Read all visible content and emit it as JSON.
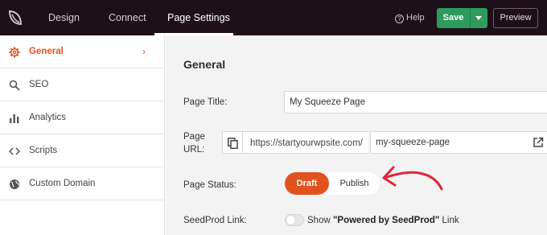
{
  "header": {
    "tabs": [
      {
        "label": "Design",
        "active": false
      },
      {
        "label": "Connect",
        "active": false
      },
      {
        "label": "Page Settings",
        "active": true
      }
    ],
    "help_label": "Help",
    "save_label": "Save",
    "preview_label": "Preview"
  },
  "sidebar": {
    "items": [
      {
        "label": "General",
        "icon": "gear-icon",
        "active": true
      },
      {
        "label": "SEO",
        "icon": "search-icon",
        "active": false
      },
      {
        "label": "Analytics",
        "icon": "bar-chart-icon",
        "active": false
      },
      {
        "label": "Scripts",
        "icon": "code-icon",
        "active": false
      },
      {
        "label": "Custom Domain",
        "icon": "globe-icon",
        "active": false
      }
    ]
  },
  "main": {
    "title": "General",
    "page_title": {
      "label": "Page Title:",
      "value": "My Squeeze Page"
    },
    "page_url": {
      "label_line1": "Page",
      "label_line2": "URL:",
      "prefix": "https://startyourwpsite.com/",
      "slug": "my-squeeze-page"
    },
    "page_status": {
      "label": "Page Status:",
      "options": [
        "Draft",
        "Publish"
      ],
      "selected": "Draft"
    },
    "seedprod_link": {
      "label": "SeedProd Link:",
      "text_before": "Show ",
      "text_bold": "\"Powered by SeedProd\"",
      "text_after": " Link",
      "enabled": false
    }
  },
  "colors": {
    "topbar": "#1e1018",
    "accent": "#e0531f",
    "save_green": "#2e9b5c",
    "annotation_arrow": "#e0243a"
  }
}
